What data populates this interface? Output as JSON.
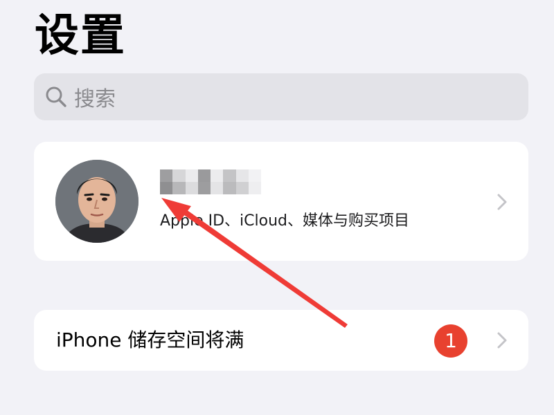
{
  "header": {
    "title": "设置"
  },
  "search": {
    "placeholder": "搜索",
    "icon": "search-icon"
  },
  "profile": {
    "name": "",
    "subtitle": "Apple ID、iCloud、媒体与购买项目",
    "avatar_icon": "avatar"
  },
  "storage_alert": {
    "label": "iPhone 储存空间将满",
    "badge_count": "1",
    "badge_color": "#e8412f"
  },
  "colors": {
    "background": "#f2f2f7",
    "card": "#ffffff",
    "search_field": "#e3e3e8",
    "annotation_arrow": "#ef3b36"
  }
}
